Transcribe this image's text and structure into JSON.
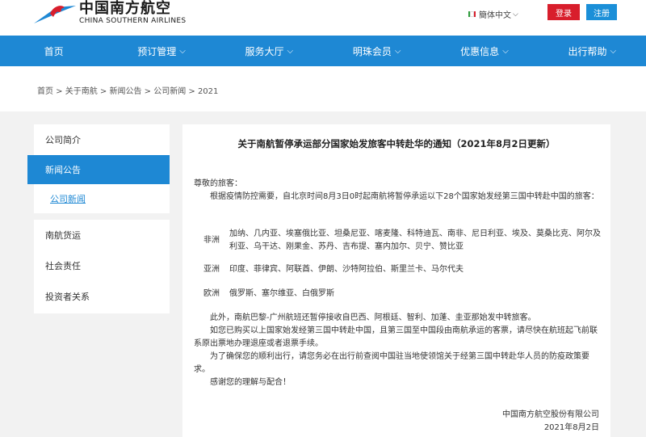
{
  "header": {
    "logo_cn": "中国南方航空",
    "logo_en": "CHINA SOUTHERN AIRLINES",
    "language": "簡体中文",
    "login_label": "登录",
    "register_label": "注册",
    "colors": {
      "red": "#d81e2c",
      "blue": "#1e88d4"
    }
  },
  "nav": [
    {
      "label": "首页",
      "dropdown": false
    },
    {
      "label": "预订管理",
      "dropdown": true
    },
    {
      "label": "服务大厅",
      "dropdown": true
    },
    {
      "label": "明珠会员",
      "dropdown": true
    },
    {
      "label": "优惠信息",
      "dropdown": true
    },
    {
      "label": "出行帮助",
      "dropdown": true
    }
  ],
  "breadcrumb": "首页 > 关于南航 > 新闻公告 > 公司新闻 > 2021",
  "sidebar": {
    "items": [
      "公司简介",
      "新闻公告"
    ],
    "sub_item": "公司新闻",
    "items2": [
      "南航货运",
      "社会责任",
      "投资者关系"
    ]
  },
  "article": {
    "title": "关于南航暂停承运部分国家始发旅客中转赴华的通知（2021年8月2日更新）",
    "greeting": "尊敬的旅客：",
    "intro": "根据疫情防控需要，自北京时间8月3日0时起南航将暂停承运以下28个国家始发经第三国中转赴中国的旅客：",
    "regions": [
      {
        "name": "非洲",
        "countries": "加纳、几内亚、埃塞俄比亚、坦桑尼亚、喀麦隆、科特迪瓦、南非、尼日利亚、埃及、莫桑比克、阿尔及利亚、乌干达、刚果金、苏丹、吉布提、塞内加尔、贝宁、赞比亚"
      },
      {
        "name": "亚洲",
        "countries": "印度、菲律宾、阿联酋、伊朗、沙特阿拉伯、斯里兰卡、马尔代夫"
      },
      {
        "name": "欧洲",
        "countries": "俄罗斯、塞尔维亚、白俄罗斯"
      }
    ],
    "p1": "此外，南航巴黎-广州航班还暂停接收自巴西、阿根廷、智利、加蓬、圭亚那始发中转旅客。",
    "p2": "如您已购买以上国家始发经第三国中转赴中国，且第三国至中国段由南航承运的客票，请尽快在航班起飞前联系原出票地办理退座或者退票手续。",
    "p3": "为了确保您的顺利出行，请您务必在出行前查阅中国驻当地使领馆关于经第三国中转赴华人员的防疫政策要求。",
    "p4": "感谢您的理解与配合！",
    "signature": "中国南方航空股份有限公司",
    "date": "2021年8月2日"
  }
}
